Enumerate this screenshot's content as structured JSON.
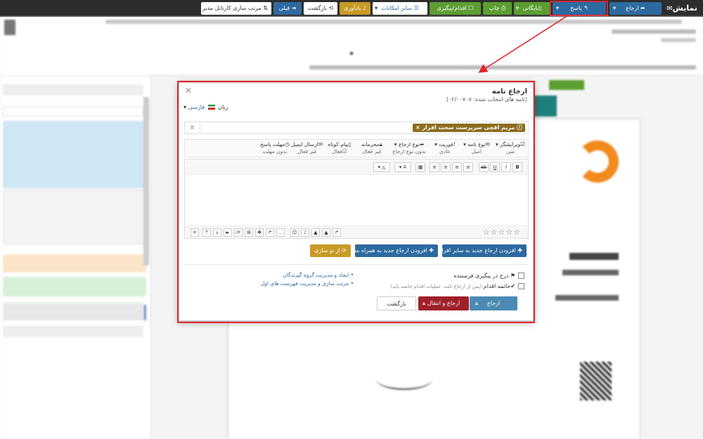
{
  "toolbar": {
    "app_title": "نمایش",
    "buttons": [
      {
        "id": "refer",
        "label": "ارجاع",
        "icon": "share-icon",
        "color": "#2d6aa0"
      },
      {
        "id": "reply",
        "label": "پاسخ",
        "icon": "reply-icon",
        "color": "#2d6aa0"
      },
      {
        "id": "archive",
        "label": "بایگانی",
        "icon": "archive-icon",
        "color": "#5c9e31"
      },
      {
        "id": "print",
        "label": "چاپ",
        "icon": "print-icon",
        "color": "#5c9e31"
      },
      {
        "id": "action",
        "label": "اقدام/پیگیری",
        "icon": "checkbox-icon",
        "color": "#5c9e31"
      },
      {
        "id": "more",
        "label": "سایر امکانات",
        "icon": "menu-icon",
        "color": "#ffffff"
      },
      {
        "id": "reminder",
        "label": "یادآوری",
        "icon": "bell-icon",
        "color": "#c89b27"
      },
      {
        "id": "back",
        "label": "بازگشت",
        "icon": "back-icon",
        "color": "#ffffff"
      },
      {
        "id": "prev",
        "label": "قبلی",
        "icon": "arrow-right-icon",
        "color": "#2d6aa0"
      },
      {
        "id": "sort",
        "label": "مرتب سازی کارتابل مدیر",
        "icon": "sort-icon",
        "color": "#ffffff"
      }
    ]
  },
  "modal": {
    "title": "ارجاع نامه",
    "subtitle": "(نامه های انتخاب شده: ۰۲/۰۰۷۰۷)",
    "language_label": "زبان",
    "language_value": "فارسی",
    "recipient": "مریم افچی سرپرست سخت افزار",
    "options": [
      {
        "label": "ویرایشگر",
        "value": "متن",
        "icon": "checkbox-icon"
      },
      {
        "label": "نوع نامه",
        "value": "اصل",
        "icon": "envelope-icon"
      },
      {
        "label": "فوریت",
        "value": "عادی",
        "icon": "exclamation-icon"
      },
      {
        "label": "نوع ارجاع",
        "value": "بدون نوع ارجاع",
        "icon": "share-icon"
      },
      {
        "label": "محرمانه",
        "value": "غیر فعال",
        "icon": "lock-icon"
      },
      {
        "label": "پیام کوتاه",
        "value": "فعال",
        "icon": "mobile-icon"
      },
      {
        "label": "ارسال ایمیل",
        "value": "غیر فعال",
        "icon": "envelope-icon"
      },
      {
        "label": "مهلت پاسخ",
        "value": "بدون مهلت",
        "icon": "clock-icon"
      }
    ],
    "buttons": {
      "add_other": "افزودن ارجاع جدید به سایر افراد",
      "add_with_text": "افزودن ارجاع جدید به همراه متن",
      "refresh": "از نو سازی"
    },
    "checks": {
      "sender_followup": "درج در پیگیری فرستنده",
      "finish_action": "خاتمه اقدام",
      "finish_hint": "(پس از ارجاع نامه، عملیات اقدام خاتمه یابد)"
    },
    "links": [
      "ایجاد و مدیریت گروه گیرندگان",
      "مرتب سازی و مدیریت فهرست های اول"
    ],
    "footer": {
      "refer": "ارجاع",
      "refer_transfer": "ارجاع و انتقال",
      "back": "بازگشت"
    }
  }
}
